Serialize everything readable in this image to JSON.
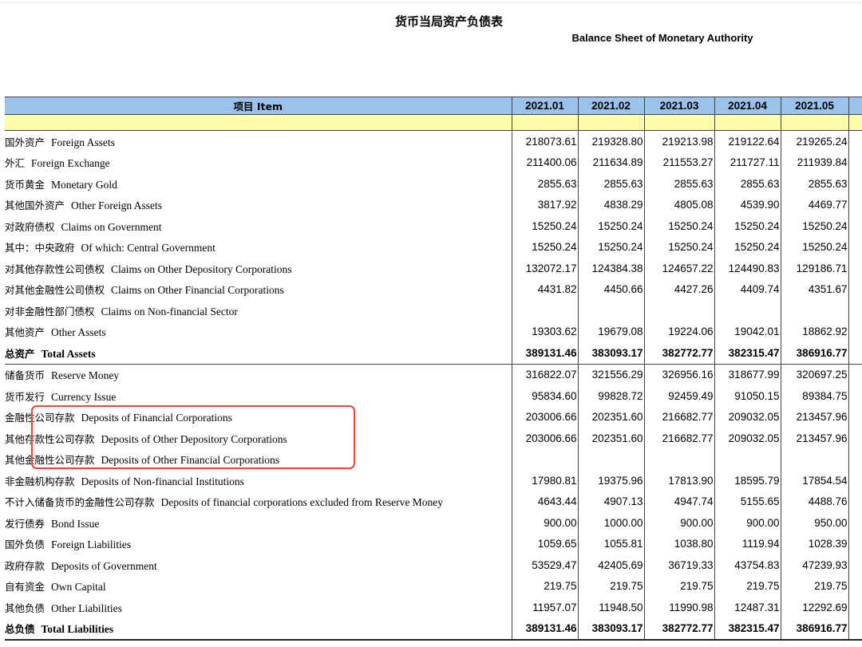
{
  "title": {
    "cn": "货币当局资产负债表",
    "en": "Balance Sheet of  Monetary Authority"
  },
  "header": {
    "item_label": "项目 Item",
    "periods": [
      "2021.01",
      "2021.02",
      "2021.03",
      "2021.04",
      "2021.05"
    ]
  },
  "rows": [
    {
      "cn": "国外资产",
      "en": "Foreign Assets",
      "indent": 1,
      "values": [
        "218073.61",
        "219328.80",
        "219213.98",
        "219122.64",
        "219265.24"
      ]
    },
    {
      "cn": "外汇",
      "en": "Foreign Exchange",
      "indent": 2,
      "values": [
        "211400.06",
        "211634.89",
        "211553.27",
        "211727.11",
        "211939.84"
      ]
    },
    {
      "cn": "货币黄金",
      "en": "Monetary Gold",
      "indent": 2,
      "values": [
        "2855.63",
        "2855.63",
        "2855.63",
        "2855.63",
        "2855.63"
      ]
    },
    {
      "cn": "其他国外资产",
      "en": "Other Foreign Assets",
      "indent": 2,
      "values": [
        "3817.92",
        "4838.29",
        "4805.08",
        "4539.90",
        "4469.77"
      ]
    },
    {
      "cn": "对政府债权",
      "en": "Claims on Government",
      "indent": 1,
      "values": [
        "15250.24",
        "15250.24",
        "15250.24",
        "15250.24",
        "15250.24"
      ]
    },
    {
      "cn": "其中：中央政府",
      "en": "Of which: Central Government",
      "indent": 2,
      "values": [
        "15250.24",
        "15250.24",
        "15250.24",
        "15250.24",
        "15250.24"
      ]
    },
    {
      "cn": "对其他存款性公司债权",
      "en": "Claims on Other Depository Corporations",
      "indent": 1,
      "values": [
        "132072.17",
        "124384.38",
        "124657.22",
        "124490.83",
        "129186.71"
      ]
    },
    {
      "cn": "对其他金融性公司债权",
      "en": "Claims on Other Financial Corporations",
      "indent": 1,
      "values": [
        "4431.82",
        "4450.66",
        "4427.26",
        "4409.74",
        "4351.67"
      ]
    },
    {
      "cn": "对非金融性部门债权",
      "en": "Claims on Non-financial Sector",
      "indent": 1,
      "values": [
        "",
        "",
        "",
        "",
        ""
      ]
    },
    {
      "cn": "其他资产",
      "en": "Other Assets",
      "indent": 1,
      "values": [
        "19303.62",
        "19679.08",
        "19224.06",
        "19042.01",
        "18862.92"
      ]
    },
    {
      "cn": "总资产",
      "en": "Total Assets",
      "indent": 0,
      "total": true,
      "values": [
        "389131.46",
        "383093.17",
        "382772.77",
        "382315.47",
        "386916.77"
      ]
    },
    {
      "cn": "储备货币",
      "en": "Reserve Money",
      "indent": 1,
      "values": [
        "316822.07",
        "321556.29",
        "326956.16",
        "318677.99",
        "320697.25"
      ]
    },
    {
      "cn": "货币发行",
      "en": "Currency Issue",
      "indent": 2,
      "values": [
        "95834.60",
        "99828.72",
        "92459.49",
        "91050.15",
        "89384.75"
      ]
    },
    {
      "cn": "金融性公司存款",
      "en": "Deposits of  Financial Corporations",
      "indent": 2,
      "values": [
        "203006.66",
        "202351.60",
        "216682.77",
        "209032.05",
        "213457.96"
      ]
    },
    {
      "cn": "其他存款性公司存款",
      "en": "Deposits of  Other Depository Corporations",
      "indent": 3,
      "values": [
        "203006.66",
        "202351.60",
        "216682.77",
        "209032.05",
        "213457.96"
      ]
    },
    {
      "cn": "其他金融性公司存款",
      "en": "Deposits of  Other Financial Corporations",
      "indent": 3,
      "values": [
        "",
        "",
        "",
        "",
        ""
      ]
    },
    {
      "cn": "非金融机构存款",
      "en": "Deposits of  Non-financial Institutions",
      "indent": 2,
      "values": [
        "17980.81",
        "19375.96",
        "17813.90",
        "18595.79",
        "17854.54"
      ]
    },
    {
      "cn": "不计入储备货币的金融性公司存款",
      "en": "Deposits of financial corporations excluded from Reserve Money",
      "indent": 1,
      "values": [
        "4643.44",
        "4907.13",
        "4947.74",
        "5155.65",
        "4488.76"
      ]
    },
    {
      "cn": "发行债券",
      "en": "Bond Issue",
      "indent": 1,
      "values": [
        "900.00",
        "1000.00",
        "900.00",
        "900.00",
        "950.00"
      ]
    },
    {
      "cn": "国外负债",
      "en": "Foreign Liabilities",
      "indent": 1,
      "values": [
        "1059.65",
        "1055.81",
        "1038.80",
        "1119.94",
        "1028.39"
      ]
    },
    {
      "cn": "政府存款",
      "en": "Deposits of Government",
      "indent": 1,
      "values": [
        "53529.47",
        "42405.69",
        "36719.33",
        "43754.83",
        "47239.93"
      ]
    },
    {
      "cn": "自有资金",
      "en": "Own Capital",
      "indent": 1,
      "values": [
        "219.75",
        "219.75",
        "219.75",
        "219.75",
        "219.75"
      ]
    },
    {
      "cn": "其他负债",
      "en": "Other Liabilities",
      "indent": 1,
      "values": [
        "11957.07",
        "11948.50",
        "11990.98",
        "12487.31",
        "12292.69"
      ]
    },
    {
      "cn": "总负债",
      "en": "Total  Liabilities",
      "indent": 0,
      "total": true,
      "values": [
        "389131.46",
        "383093.17",
        "382772.77",
        "382315.47",
        "386916.77"
      ]
    }
  ],
  "colors": {
    "header_bg": "#9bc2ea",
    "band_bg": "#fffba8",
    "highlight_border": "#e8493f"
  }
}
